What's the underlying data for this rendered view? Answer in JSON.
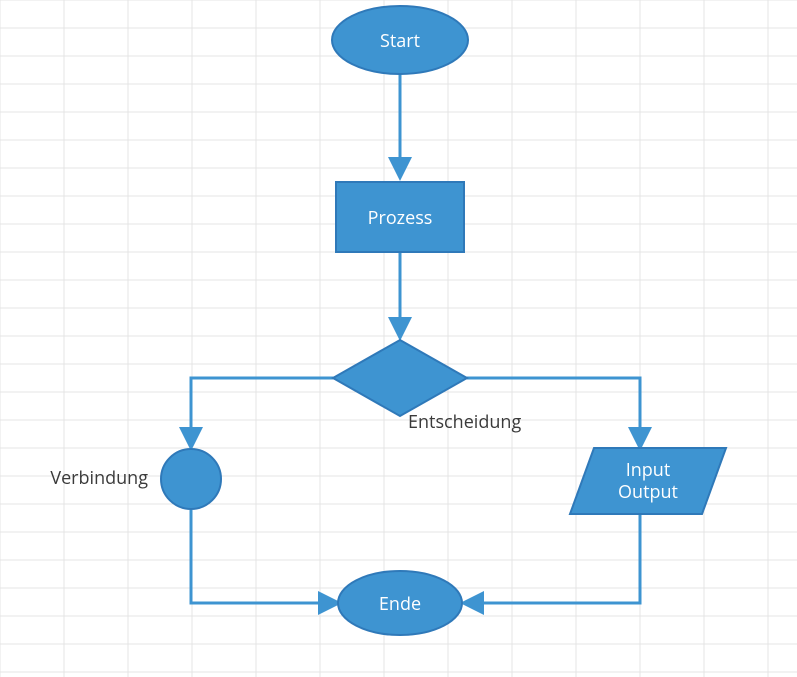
{
  "flowchart": {
    "colors": {
      "shape_fill": "#3e94d1",
      "shape_stroke": "#2f79b9",
      "grid": "#e4e4e4",
      "text_on_shape": "#ffffff",
      "text_external": "#3a3a3a"
    },
    "nodes": {
      "start": {
        "type": "terminator",
        "label": "Start"
      },
      "process": {
        "type": "process",
        "label": "Prozess"
      },
      "decision": {
        "type": "decision",
        "label": "Entscheidung"
      },
      "connector": {
        "type": "connector",
        "label": "Verbindung"
      },
      "io": {
        "type": "io",
        "label_line1": "Input",
        "label_line2": "Output"
      },
      "end": {
        "type": "terminator",
        "label": "Ende"
      }
    },
    "edges": [
      {
        "from": "start",
        "to": "process"
      },
      {
        "from": "process",
        "to": "decision"
      },
      {
        "from": "decision",
        "to": "connector"
      },
      {
        "from": "decision",
        "to": "io"
      },
      {
        "from": "connector",
        "to": "end"
      },
      {
        "from": "io",
        "to": "end"
      }
    ]
  }
}
